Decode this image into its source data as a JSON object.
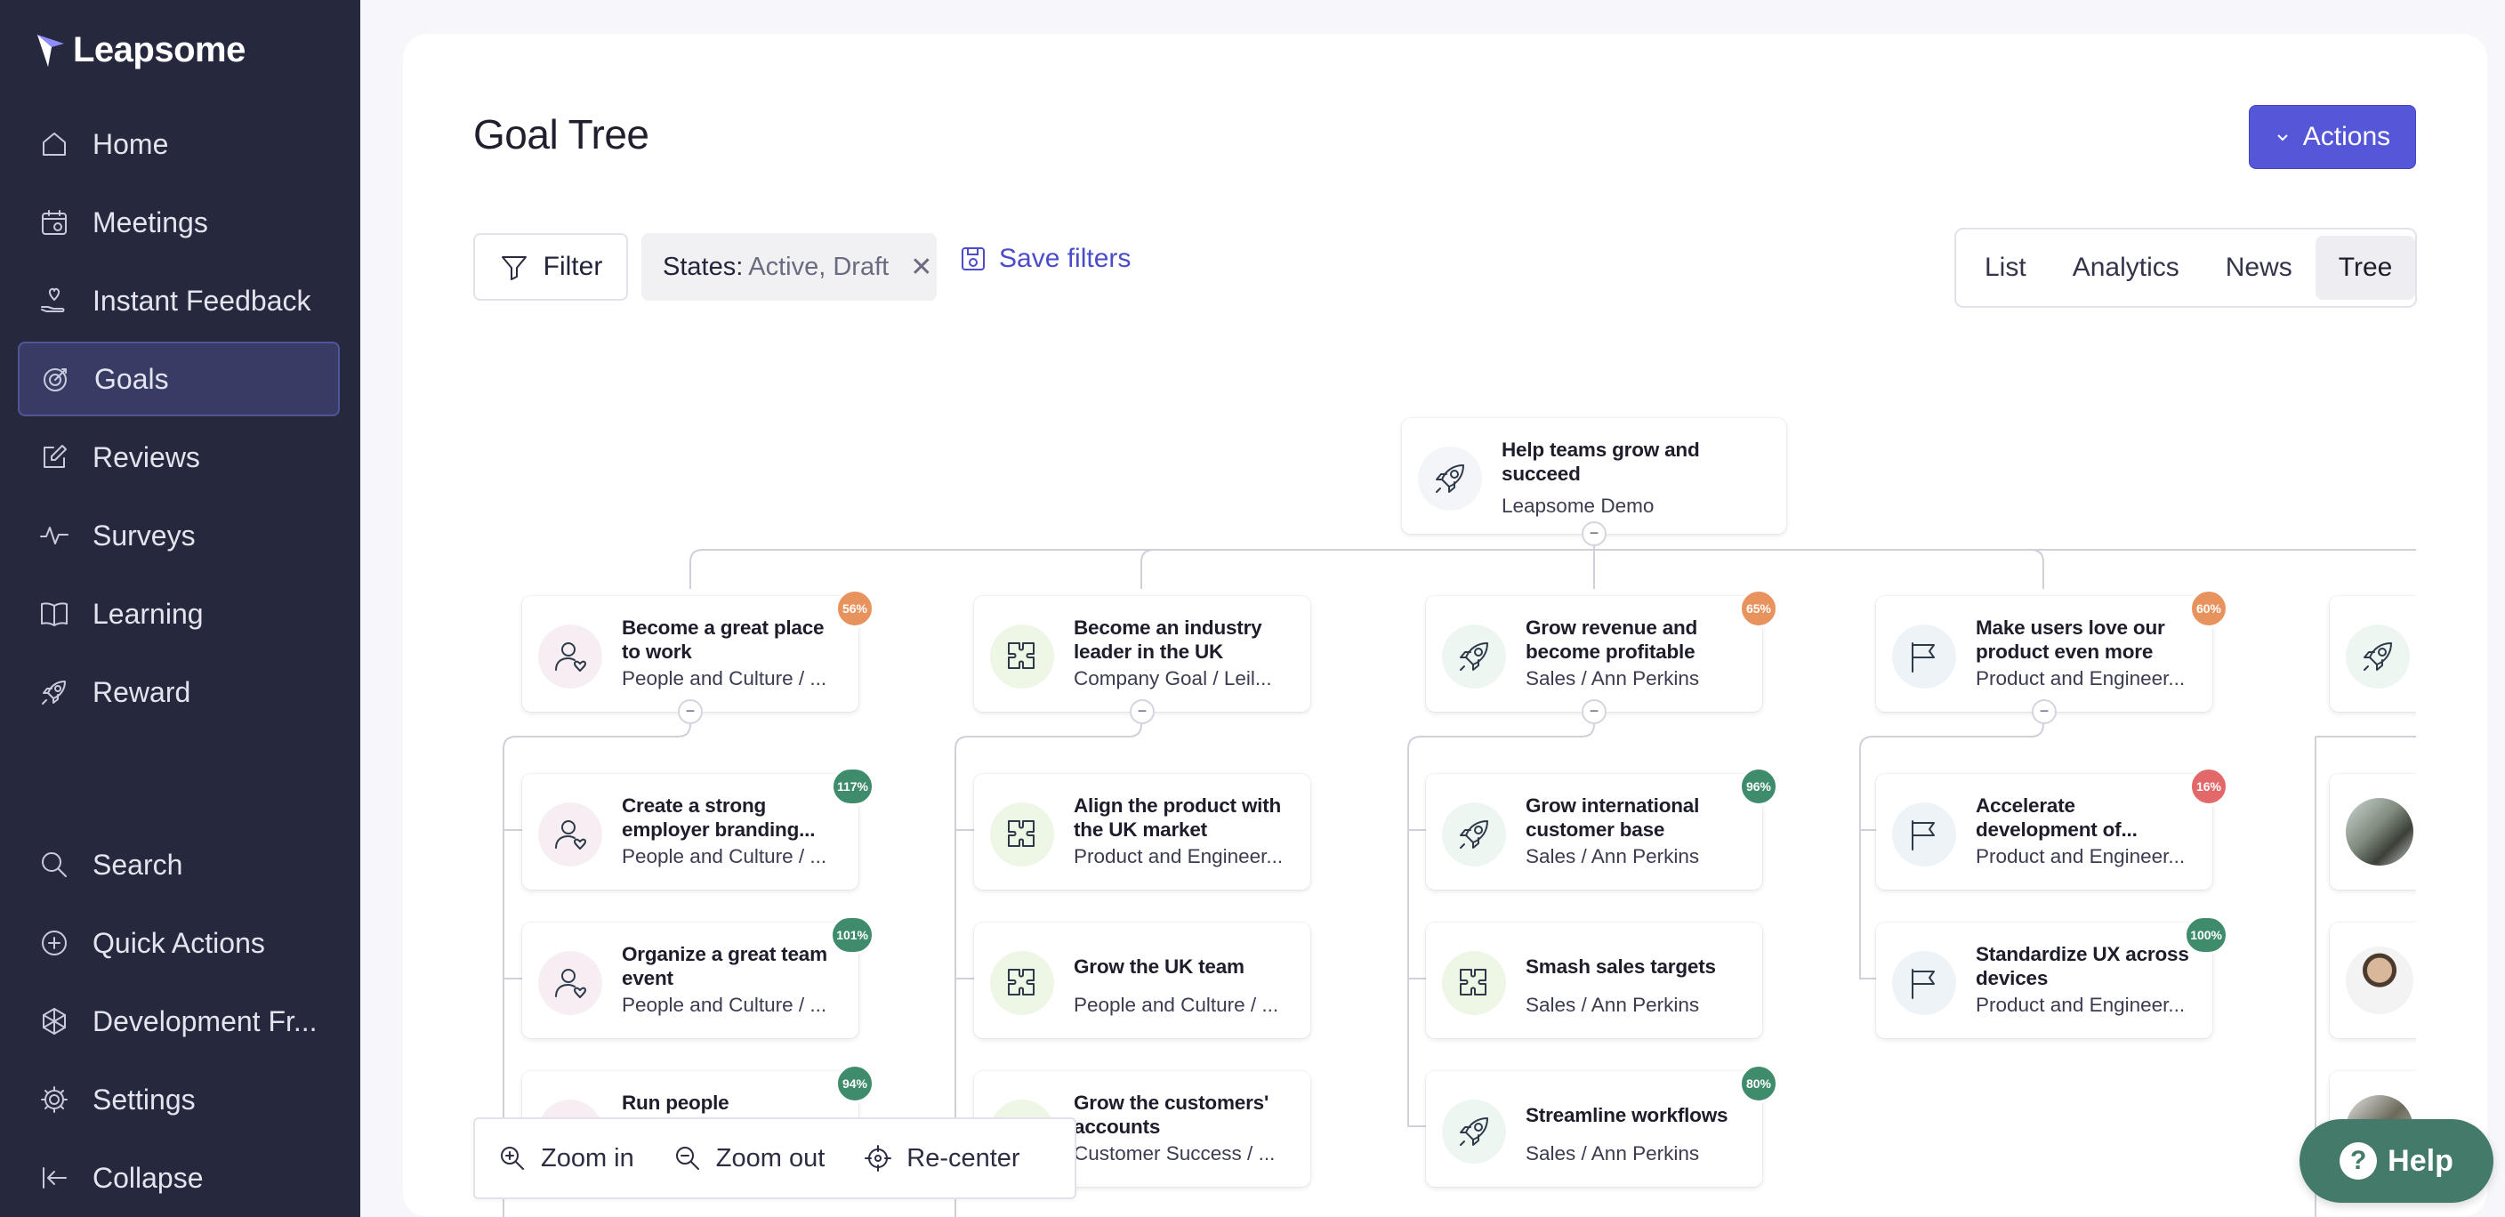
{
  "brand": {
    "name": "Leapsome"
  },
  "sidebar": {
    "items": [
      {
        "label": "Home",
        "icon": "home-icon"
      },
      {
        "label": "Meetings",
        "icon": "calendar-icon"
      },
      {
        "label": "Instant Feedback",
        "icon": "hand-heart-icon"
      },
      {
        "label": "Goals",
        "icon": "target-icon",
        "active": true
      },
      {
        "label": "Reviews",
        "icon": "edit-icon"
      },
      {
        "label": "Surveys",
        "icon": "pulse-icon"
      },
      {
        "label": "Learning",
        "icon": "book-icon"
      },
      {
        "label": "Reward",
        "icon": "rocket-icon"
      }
    ],
    "bottom_items": [
      {
        "label": "Search",
        "icon": "search-icon"
      },
      {
        "label": "Quick Actions",
        "icon": "plus-circle-icon"
      },
      {
        "label": "Development Fr...",
        "icon": "framework-icon"
      },
      {
        "label": "Settings",
        "icon": "gear-icon"
      },
      {
        "label": "Collapse",
        "icon": "collapse-icon"
      }
    ]
  },
  "header": {
    "title": "Goal Tree",
    "actions_label": "Actions"
  },
  "filters": {
    "filter_label": "Filter",
    "states_key": "States:",
    "states_value": "Active, Draft",
    "save_label": "Save filters"
  },
  "view_tabs": [
    {
      "label": "List"
    },
    {
      "label": "Analytics"
    },
    {
      "label": "News"
    },
    {
      "label": "Tree",
      "active": true
    }
  ],
  "tree": {
    "root": {
      "title": "Help teams grow and succeed",
      "owner": "Leapsome Demo",
      "icon": "rocket-icon"
    },
    "columns": [
      {
        "parent": {
          "title": "Become a great place to work",
          "owner": "People and Culture / ...",
          "progress": "56%",
          "status": "orange",
          "icon": "user-heart-icon"
        },
        "children": [
          {
            "title": "Create a strong employer branding...",
            "owner": "People and Culture / ...",
            "progress": "117%",
            "status": "green",
            "icon": "user-heart-icon"
          },
          {
            "title": "Organize a great team event",
            "owner": "People and Culture / ...",
            "progress": "101%",
            "status": "green",
            "icon": "user-heart-icon"
          },
          {
            "title": "Run people",
            "owner": "",
            "progress": "94%",
            "status": "green",
            "icon": "user-heart-icon"
          }
        ]
      },
      {
        "parent": {
          "title": "Become an industry leader in the UK",
          "owner": "Company Goal / Leil...",
          "progress": "",
          "status": "",
          "icon": "puzzle-icon"
        },
        "children": [
          {
            "title": "Align the product with the UK market",
            "owner": "Product and Engineer...",
            "progress": "",
            "status": "",
            "icon": "puzzle-icon"
          },
          {
            "title": "Grow the UK team",
            "owner": "People and Culture / ...",
            "progress": "",
            "status": "",
            "icon": "puzzle-icon"
          },
          {
            "title": "Grow the customers' accounts",
            "owner": "Customer Success / ...",
            "progress": "",
            "status": "",
            "icon": "puzzle-icon"
          }
        ]
      },
      {
        "parent": {
          "title": "Grow revenue and become profitable",
          "owner": "Sales / Ann Perkins",
          "progress": "65%",
          "status": "orange",
          "icon": "rocket-icon"
        },
        "children": [
          {
            "title": "Grow international customer base",
            "owner": "Sales / Ann Perkins",
            "progress": "96%",
            "status": "green",
            "icon": "rocket-icon"
          },
          {
            "title": "Smash sales targets",
            "owner": "Sales / Ann Perkins",
            "progress": "",
            "status": "",
            "icon": "puzzle-icon"
          },
          {
            "title": "Streamline workflows",
            "owner": "Sales / Ann Perkins",
            "progress": "80%",
            "status": "green",
            "icon": "rocket-icon"
          }
        ]
      },
      {
        "parent": {
          "title": "Make users love our product even more",
          "owner": "Product and Engineer...",
          "progress": "60%",
          "status": "orange",
          "icon": "flag-icon"
        },
        "children": [
          {
            "title": "Accelerate development of...",
            "owner": "Product and Engineer...",
            "progress": "16%",
            "status": "red",
            "icon": "flag-icon"
          },
          {
            "title": "Standardize UX across devices",
            "owner": "Product and Engineer...",
            "progress": "100%",
            "status": "green",
            "icon": "flag-icon"
          }
        ]
      }
    ],
    "collapse_symbol": "−"
  },
  "zoom": {
    "zoom_in": "Zoom in",
    "zoom_out": "Zoom out",
    "recenter": "Re-center"
  },
  "help": {
    "label": "Help",
    "symbol": "?"
  },
  "colors": {
    "sidebar_bg": "#26283d",
    "accent": "#5657d8",
    "progress_green": "#3e8c6c",
    "progress_orange": "#e8935e",
    "progress_red": "#e2686a",
    "help_bg": "#437a6a"
  }
}
